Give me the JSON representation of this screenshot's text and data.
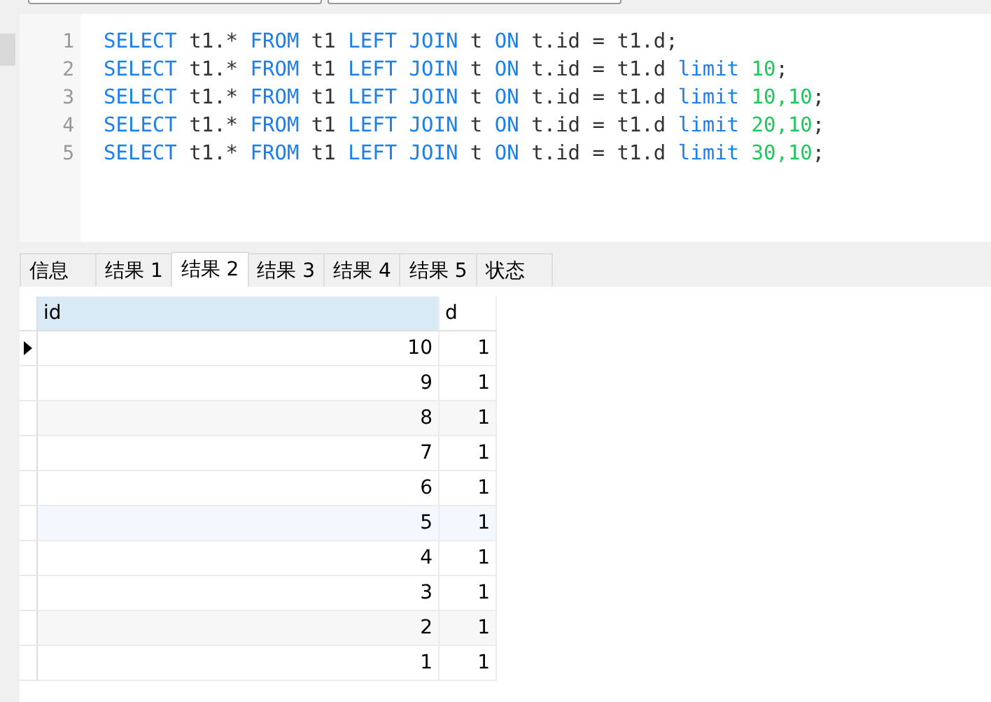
{
  "editor": {
    "lines": [
      {
        "number": "1",
        "tokens": [
          {
            "kind": "keyword",
            "text": "SELECT"
          },
          {
            "kind": "plain",
            "text": " t1.* "
          },
          {
            "kind": "keyword",
            "text": "FROM"
          },
          {
            "kind": "plain",
            "text": " t1 "
          },
          {
            "kind": "keyword",
            "text": "LEFT JOIN"
          },
          {
            "kind": "plain",
            "text": " t "
          },
          {
            "kind": "keyword",
            "text": "ON"
          },
          {
            "kind": "plain",
            "text": " t.id = t1.d;"
          }
        ]
      },
      {
        "number": "2",
        "tokens": [
          {
            "kind": "keyword",
            "text": "SELECT"
          },
          {
            "kind": "plain",
            "text": " t1.* "
          },
          {
            "kind": "keyword",
            "text": "FROM"
          },
          {
            "kind": "plain",
            "text": " t1 "
          },
          {
            "kind": "keyword",
            "text": "LEFT JOIN"
          },
          {
            "kind": "plain",
            "text": " t "
          },
          {
            "kind": "keyword",
            "text": "ON"
          },
          {
            "kind": "plain",
            "text": " t.id = t1.d "
          },
          {
            "kind": "keyword",
            "text": "limit"
          },
          {
            "kind": "number",
            "text": " 10"
          },
          {
            "kind": "plain",
            "text": ";"
          }
        ]
      },
      {
        "number": "3",
        "tokens": [
          {
            "kind": "keyword",
            "text": "SELECT"
          },
          {
            "kind": "plain",
            "text": " t1.* "
          },
          {
            "kind": "keyword",
            "text": "FROM"
          },
          {
            "kind": "plain",
            "text": " t1 "
          },
          {
            "kind": "keyword",
            "text": "LEFT JOIN"
          },
          {
            "kind": "plain",
            "text": " t "
          },
          {
            "kind": "keyword",
            "text": "ON"
          },
          {
            "kind": "plain",
            "text": " t.id = t1.d "
          },
          {
            "kind": "keyword",
            "text": "limit"
          },
          {
            "kind": "number",
            "text": " 10,10"
          },
          {
            "kind": "plain",
            "text": ";"
          }
        ]
      },
      {
        "number": "4",
        "tokens": [
          {
            "kind": "keyword",
            "text": "SELECT"
          },
          {
            "kind": "plain",
            "text": " t1.* "
          },
          {
            "kind": "keyword",
            "text": "FROM"
          },
          {
            "kind": "plain",
            "text": " t1 "
          },
          {
            "kind": "keyword",
            "text": "LEFT JOIN"
          },
          {
            "kind": "plain",
            "text": " t "
          },
          {
            "kind": "keyword",
            "text": "ON"
          },
          {
            "kind": "plain",
            "text": " t.id = t1.d "
          },
          {
            "kind": "keyword",
            "text": "limit"
          },
          {
            "kind": "number",
            "text": " 20,10"
          },
          {
            "kind": "plain",
            "text": ";"
          }
        ]
      },
      {
        "number": "5",
        "tokens": [
          {
            "kind": "keyword",
            "text": "SELECT"
          },
          {
            "kind": "plain",
            "text": " t1.* "
          },
          {
            "kind": "keyword",
            "text": "FROM"
          },
          {
            "kind": "plain",
            "text": " t1 "
          },
          {
            "kind": "keyword",
            "text": "LEFT JOIN"
          },
          {
            "kind": "plain",
            "text": " t "
          },
          {
            "kind": "keyword",
            "text": "ON"
          },
          {
            "kind": "plain",
            "text": " t.id = t1.d "
          },
          {
            "kind": "keyword",
            "text": "limit"
          },
          {
            "kind": "number",
            "text": " 30,10"
          },
          {
            "kind": "plain",
            "text": ";"
          }
        ]
      }
    ]
  },
  "tabs": [
    {
      "label": "信息",
      "selected": false
    },
    {
      "label": "结果 1",
      "selected": false
    },
    {
      "label": "结果 2",
      "selected": true
    },
    {
      "label": "结果 3",
      "selected": false
    },
    {
      "label": "结果 4",
      "selected": false
    },
    {
      "label": "结果 5",
      "selected": false
    },
    {
      "label": "状态",
      "selected": false
    }
  ],
  "table": {
    "columns": [
      {
        "label": "id",
        "selected": true
      },
      {
        "label": "d",
        "selected": false
      }
    ],
    "rows": [
      {
        "cells": [
          "10",
          "1"
        ],
        "selected": true,
        "kind": "plain"
      },
      {
        "cells": [
          "9",
          "1"
        ],
        "selected": false,
        "kind": "plain"
      },
      {
        "cells": [
          "8",
          "1"
        ],
        "selected": false,
        "kind": "striped"
      },
      {
        "cells": [
          "7",
          "1"
        ],
        "selected": false,
        "kind": "plain"
      },
      {
        "cells": [
          "6",
          "1"
        ],
        "selected": false,
        "kind": "plain"
      },
      {
        "cells": [
          "5",
          "1"
        ],
        "selected": false,
        "kind": "hover"
      },
      {
        "cells": [
          "4",
          "1"
        ],
        "selected": false,
        "kind": "plain"
      },
      {
        "cells": [
          "3",
          "1"
        ],
        "selected": false,
        "kind": "plain"
      },
      {
        "cells": [
          "2",
          "1"
        ],
        "selected": false,
        "kind": "striped"
      },
      {
        "cells": [
          "1",
          "1"
        ],
        "selected": false,
        "kind": "plain"
      }
    ]
  }
}
